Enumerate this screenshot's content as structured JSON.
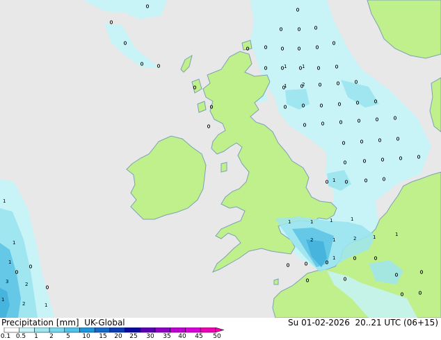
{
  "map": {
    "colors": {
      "sea": "#e8e8e8",
      "land": "#bff08c",
      "coast": "#7ca0b4",
      "precip_light": "#c8f4f8",
      "precip_mid": "#a0e6f0",
      "precip_heavy": "#64c8e6",
      "precip_heavier": "#46b4dc",
      "marker": "#000000"
    },
    "value_labels": [
      "1",
      "2",
      "3",
      "1",
      "2",
      "1",
      "1",
      "1",
      "2",
      "1",
      "1",
      "1",
      "2",
      "1",
      "1",
      "1",
      "1",
      "1",
      "1",
      "2",
      "1",
      "1",
      "1"
    ]
  },
  "footer": {
    "title": "Precipitation [mm]  UK-Global",
    "valid_time": "Su 01-02-2026  20..21 UTC (06+15)",
    "legend": {
      "ticks": [
        "0.1",
        "0.5",
        "1",
        "2",
        "5",
        "10",
        "15",
        "20",
        "25",
        "30",
        "35",
        "40",
        "45",
        "50"
      ],
      "colors": [
        "#ffffff",
        "#c8f4f8",
        "#a0e6f0",
        "#78d7ef",
        "#50c3ea",
        "#1e96dc",
        "#1469c8",
        "#0a3cb4",
        "#0a0aa0",
        "#5a00b4",
        "#8c00c8",
        "#be00d2",
        "#dc00dc",
        "#f000b4"
      ]
    }
  }
}
